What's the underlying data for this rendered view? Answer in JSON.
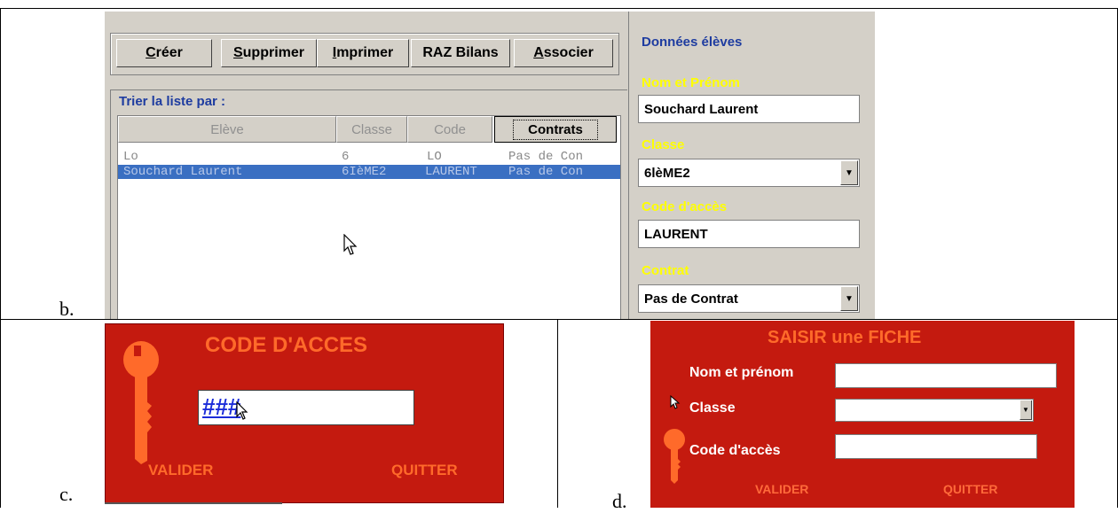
{
  "captions": {
    "b": "b.",
    "c": "c.",
    "d": "d."
  },
  "panel_b": {
    "toolbar": [
      {
        "prefix": "",
        "accel": "C",
        "rest": "réer"
      },
      {
        "prefix": "",
        "accel": "S",
        "rest": "upprimer"
      },
      {
        "prefix": "",
        "accel": "I",
        "rest": "mprimer"
      },
      {
        "prefix": "RAZ Bilans",
        "accel": "",
        "rest": ""
      },
      {
        "prefix": "",
        "accel": "A",
        "rest": "ssocier"
      }
    ],
    "sort_label": "Trier la liste par :",
    "columns": [
      "Elève",
      "Classe",
      "Code",
      "Contrats"
    ],
    "rows": [
      {
        "eleve": "Lo",
        "classe": "6",
        "code": "LO",
        "contrat": "Pas de Con"
      },
      {
        "eleve": "Souchard Laurent",
        "classe": "6IèME2",
        "code": "LAURENT",
        "contrat": "Pas de Con"
      }
    ],
    "right": {
      "title": "Données élèves",
      "name_label": "Nom et Prénom",
      "name_value": "Souchard Laurent",
      "class_label": "Classe",
      "class_value": "6lèME2",
      "code_label": "Code d'accès",
      "code_value": "LAURENT",
      "contract_label": "Contrat",
      "contract_value": "Pas de Contrat"
    }
  },
  "panel_c": {
    "title": "CODE D'ACCES",
    "input_value": "###",
    "validate": "VALIDER",
    "quit": "QUITTER"
  },
  "panel_d": {
    "title": "SAISIR une FICHE",
    "name_label": "Nom et prénom",
    "class_label": "Classe",
    "code_label": "Code d'accès",
    "validate": "VALIDER",
    "quit": "QUITTER"
  },
  "colors": {
    "red_panel": "#c41a0f",
    "orange_text": "#ff6a2a",
    "blue_label": "#1e3ca0",
    "selection": "#3a6fc2",
    "yellow_label": "#ffff00"
  }
}
